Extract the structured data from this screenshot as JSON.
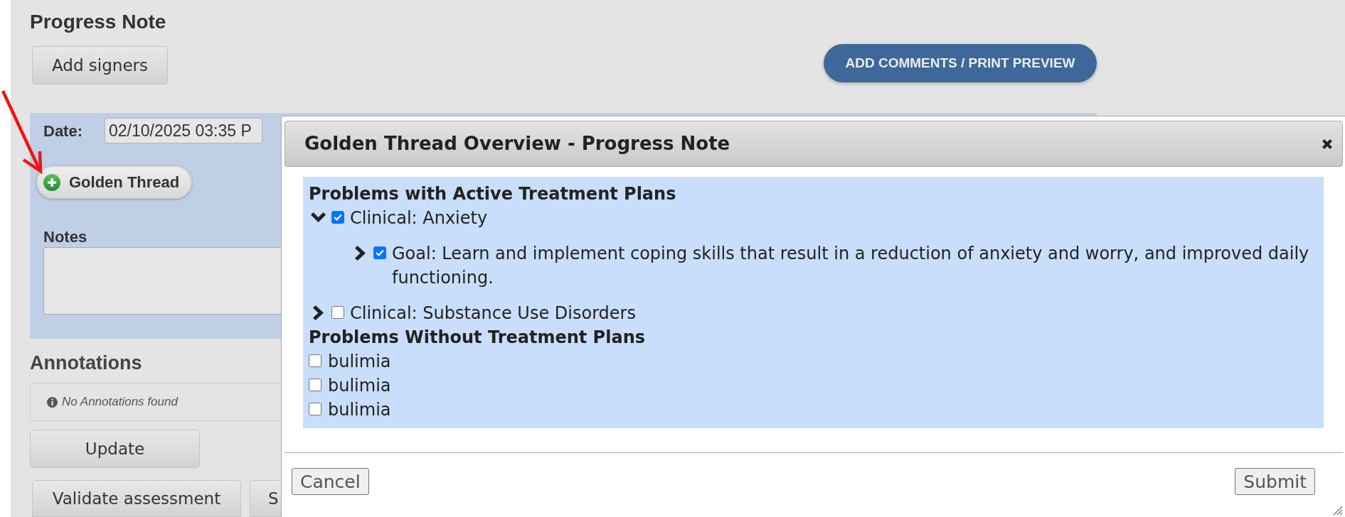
{
  "page": {
    "title": "Progress Note",
    "add_signers": "Add signers",
    "print_preview": "ADD COMMENTS / PRINT PREVIEW"
  },
  "form": {
    "date_label": "Date:",
    "date_value": "02/10/2025 03:35 P",
    "golden_thread": "Golden Thread",
    "notes_label": "Notes"
  },
  "annotations": {
    "heading": "Annotations",
    "empty_message": "No Annotations found",
    "update": "Update"
  },
  "actions": [
    "Validate assessment",
    "S"
  ],
  "modal": {
    "title": "Golden Thread Overview - Progress Note",
    "sections": [
      {
        "heading": "Problems with Active Treatment Plans",
        "items": [
          {
            "label": "Clinical: Anxiety",
            "checked": true,
            "expanded": true,
            "children": [
              {
                "label": "Goal: Learn and implement coping skills that result in a reduction of anxiety and worry, and improved daily functioning.",
                "checked": true,
                "expanded": false
              }
            ]
          },
          {
            "label": "Clinical: Substance Use Disorders",
            "checked": false,
            "expanded": false
          }
        ]
      },
      {
        "heading": "Problems Without Treatment Plans",
        "items": [
          {
            "label": "bulimia",
            "checked": false
          },
          {
            "label": "bulimia",
            "checked": false
          },
          {
            "label": "bulimia",
            "checked": false
          }
        ]
      }
    ],
    "buttons": [
      "Cancel",
      "Submit"
    ]
  }
}
